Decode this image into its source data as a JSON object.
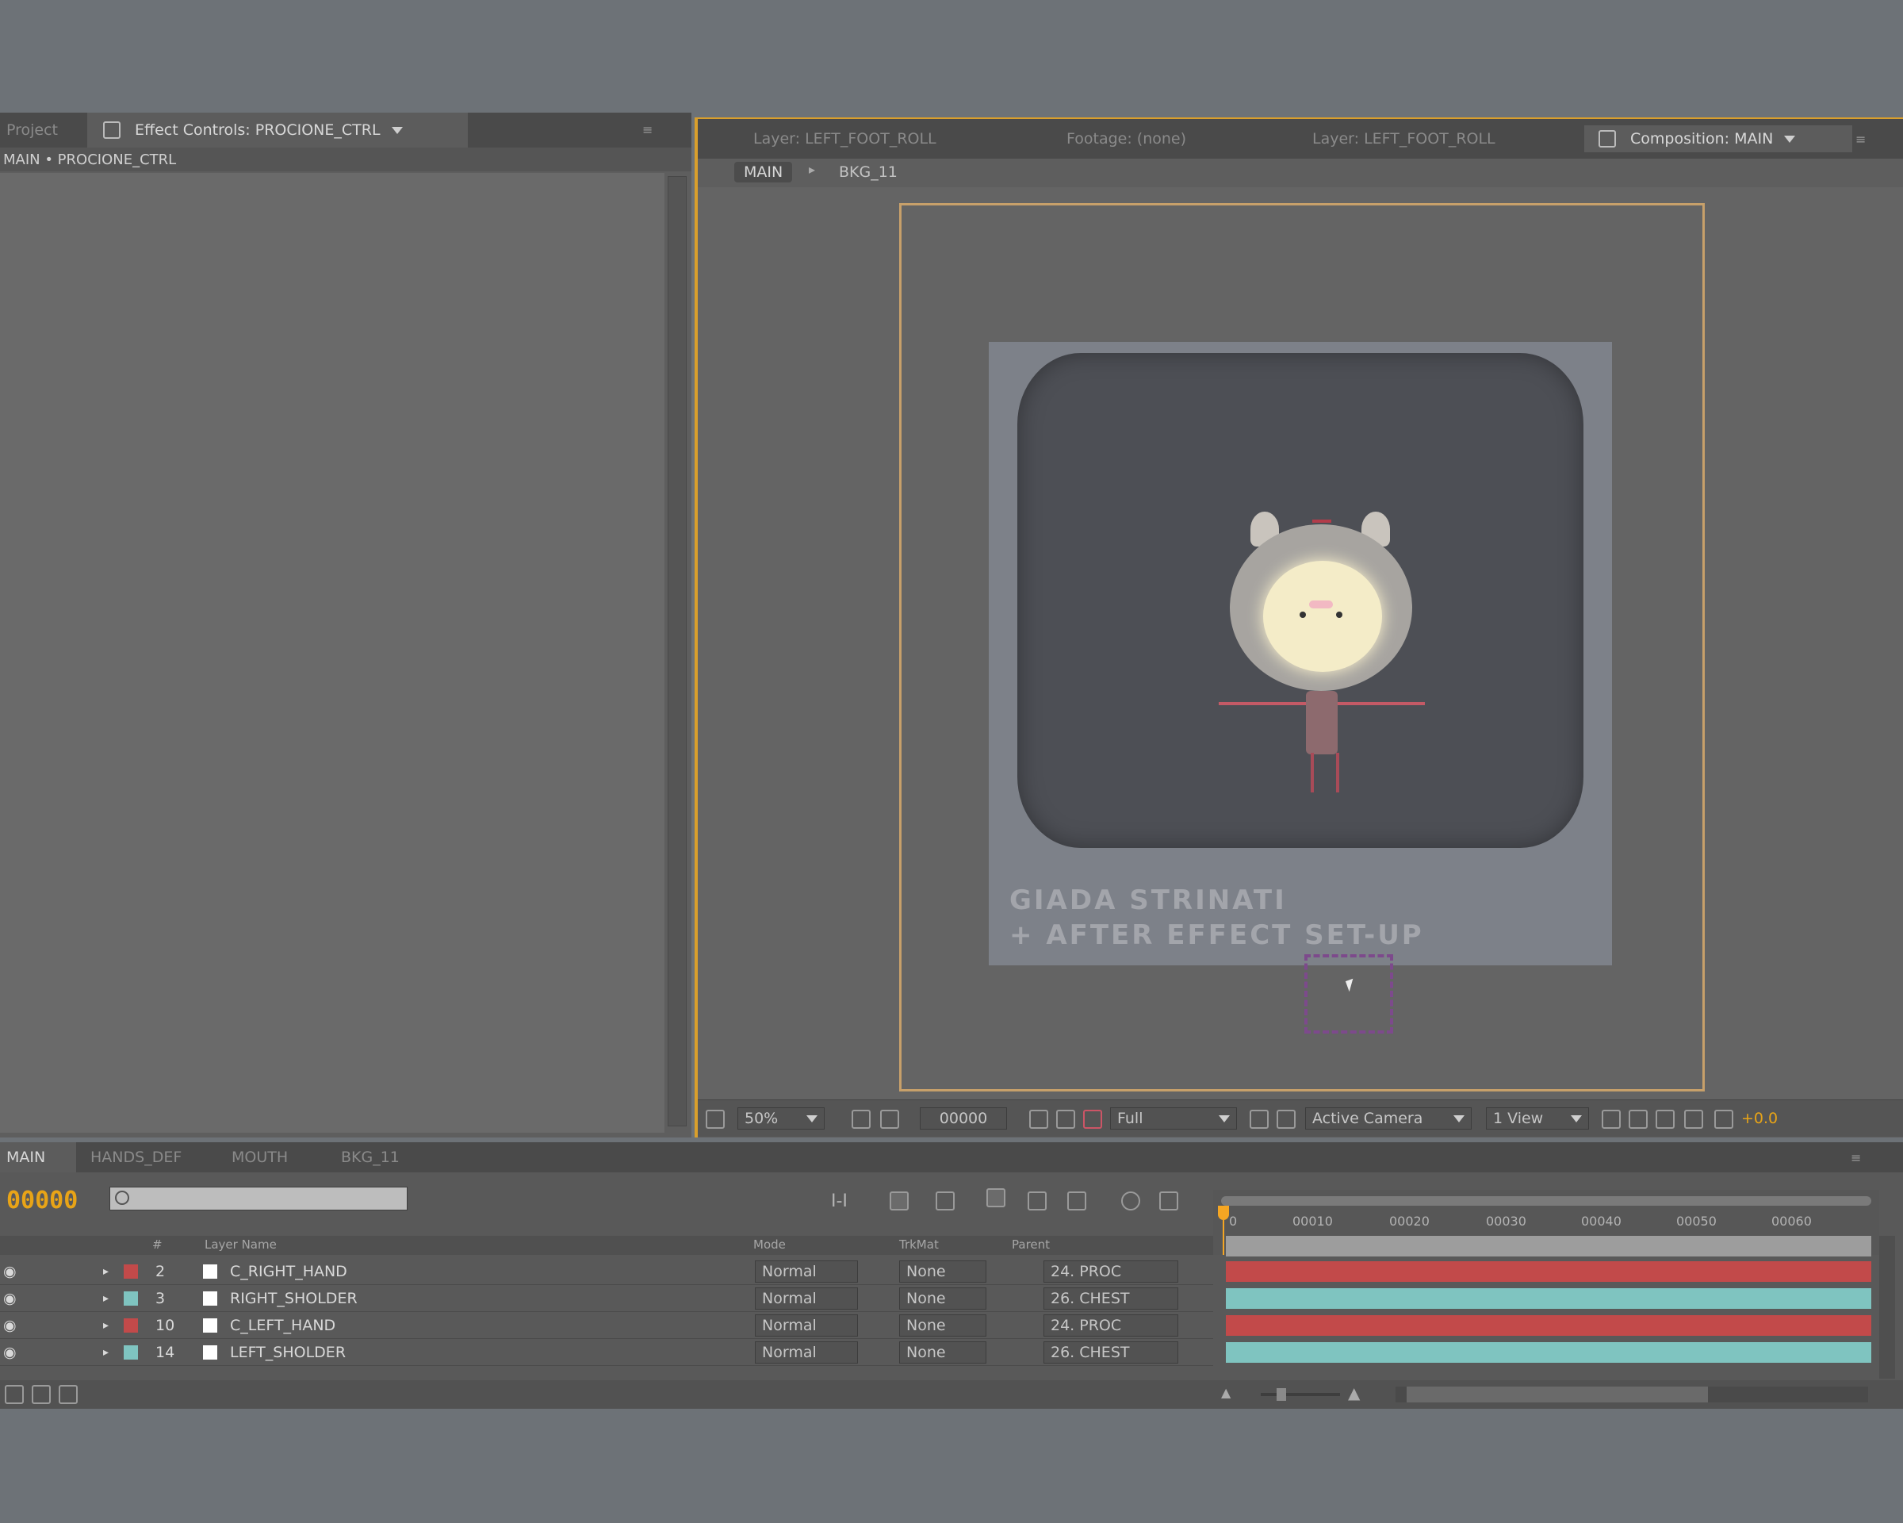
{
  "left_panel": {
    "tab_project": "Project",
    "tab_effect_controls": "Effect Controls: PROCIONE_CTRL",
    "breadcrumb": "MAIN • PROCIONE_CTRL"
  },
  "viewer": {
    "tabs": [
      {
        "label": "Layer: LEFT_FOOT_ROLL"
      },
      {
        "label": "Footage: (none)"
      },
      {
        "label": "Layer: LEFT_FOOT_ROLL"
      },
      {
        "label": "Composition: MAIN"
      }
    ],
    "flow": {
      "current": "MAIN",
      "next": "BKG_11"
    },
    "watermark_line1": "GIADA STRINATI",
    "watermark_line2": "+ AFTER EFFECT SET-UP",
    "footer": {
      "zoom": "50%",
      "timecode": "00000",
      "resolution": "Full",
      "camera": "Active Camera",
      "views": "1 View",
      "exposure": "+0.0"
    }
  },
  "timeline": {
    "tabs": [
      {
        "label": "MAIN"
      },
      {
        "label": "HANDS_DEF"
      },
      {
        "label": "MOUTH"
      },
      {
        "label": "BKG_11"
      }
    ],
    "current_time": "00000",
    "search_placeholder": "",
    "headers": {
      "num": "#",
      "layer_name": "Layer Name",
      "mode": "Mode",
      "trkmat": "TrkMat",
      "parent": "Parent"
    },
    "ruler": [
      "0",
      "00010",
      "00020",
      "00030",
      "00040",
      "00050",
      "00060"
    ],
    "layers": [
      {
        "num": "2",
        "name": "C_RIGHT_HAND",
        "mode": "Normal",
        "trkmat": "None",
        "parent": "24. PROC",
        "color": "#c24a4a"
      },
      {
        "num": "3",
        "name": "RIGHT_SHOLDER",
        "mode": "Normal",
        "trkmat": "None",
        "parent": "26. CHEST",
        "color": "#7fc4c0"
      },
      {
        "num": "10",
        "name": "C_LEFT_HAND",
        "mode": "Normal",
        "trkmat": "None",
        "parent": "24. PROC",
        "color": "#c24a4a"
      },
      {
        "num": "14",
        "name": "LEFT_SHOLDER",
        "mode": "Normal",
        "trkmat": "None",
        "parent": "26. CHEST",
        "color": "#7fc4c0"
      }
    ]
  },
  "colors": {
    "accent": "#e8a417",
    "cti": "#f5a623",
    "red_bar": "#c24a4a",
    "teal_bar": "#7fc4c0"
  }
}
